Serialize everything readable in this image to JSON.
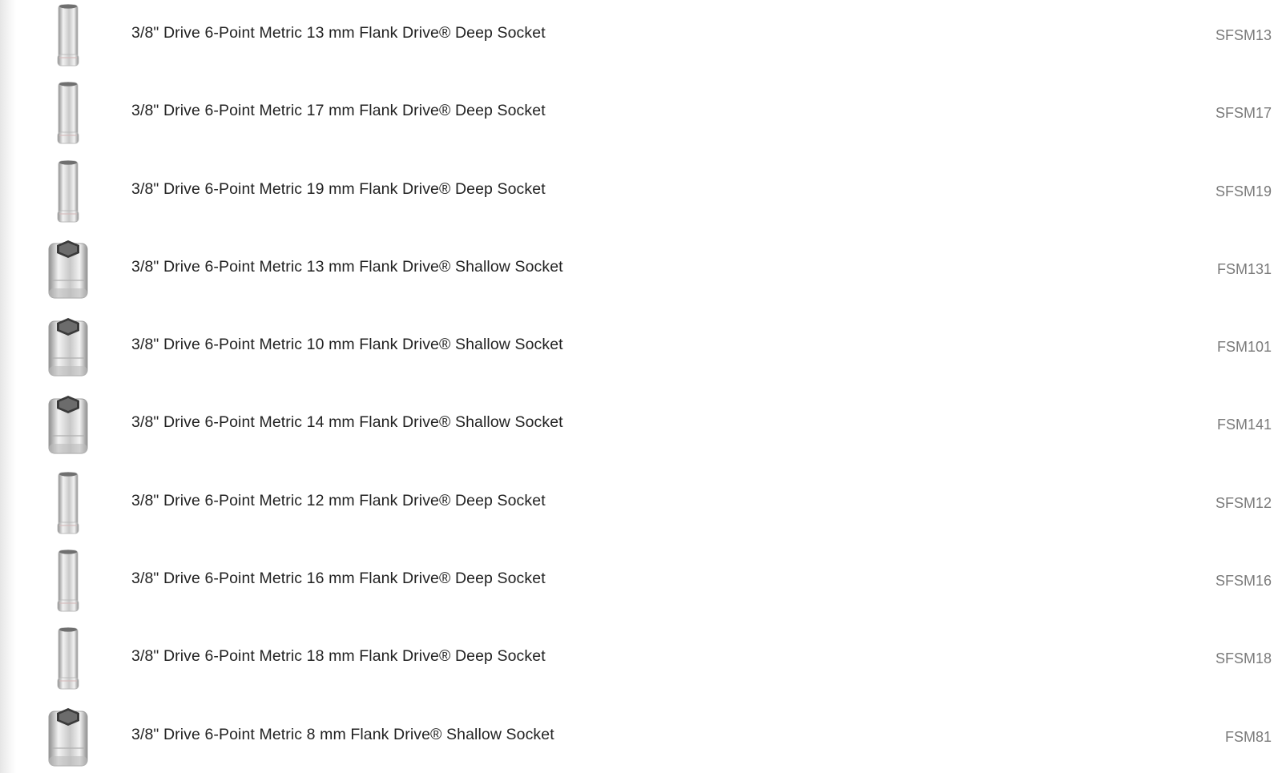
{
  "items": [
    {
      "name": "3/8\" Drive 6-Point Metric 13 mm Flank Drive® Deep Socket",
      "sku": "SFSM13",
      "socket_type": "deep"
    },
    {
      "name": "3/8\" Drive 6-Point Metric 17 mm Flank Drive® Deep Socket",
      "sku": "SFSM17",
      "socket_type": "deep"
    },
    {
      "name": "3/8\" Drive 6-Point Metric 19 mm Flank Drive® Deep Socket",
      "sku": "SFSM19",
      "socket_type": "deep"
    },
    {
      "name": "3/8\" Drive 6-Point Metric 13 mm Flank Drive® Shallow Socket",
      "sku": "FSM131",
      "socket_type": "shallow"
    },
    {
      "name": "3/8\" Drive 6-Point Metric 10 mm Flank Drive® Shallow Socket",
      "sku": "FSM101",
      "socket_type": "shallow"
    },
    {
      "name": "3/8\" Drive 6-Point Metric 14 mm Flank Drive® Shallow Socket",
      "sku": "FSM141",
      "socket_type": "shallow"
    },
    {
      "name": "3/8\" Drive 6-Point Metric 12 mm Flank Drive® Deep Socket",
      "sku": "SFSM12",
      "socket_type": "deep"
    },
    {
      "name": "3/8\" Drive 6-Point Metric 16 mm Flank Drive® Deep Socket",
      "sku": "SFSM16",
      "socket_type": "deep"
    },
    {
      "name": "3/8\" Drive 6-Point Metric 18 mm Flank Drive® Deep Socket",
      "sku": "SFSM18",
      "socket_type": "deep"
    },
    {
      "name": "3/8\" Drive 6-Point Metric 8 mm Flank Drive® Shallow Socket",
      "sku": "FSM81",
      "socket_type": "shallow"
    }
  ],
  "colors": {
    "name_text": "#222222",
    "sku_text": "#7a7a7a",
    "chrome_light": "#f2f2f2",
    "chrome_mid": "#c8c8c8",
    "chrome_dark": "#8e8e8e"
  }
}
